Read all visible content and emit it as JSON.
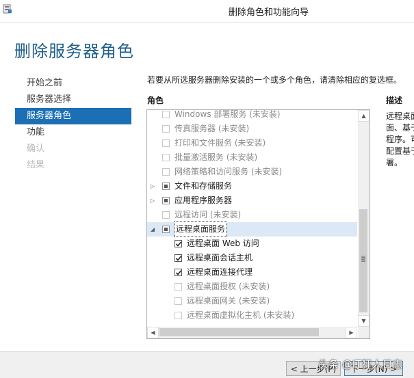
{
  "window": {
    "title": "删除角色和功能向导"
  },
  "page": {
    "title": "删除服务器角色"
  },
  "nav": {
    "items": [
      {
        "label": "开始之前"
      },
      {
        "label": "服务器选择"
      },
      {
        "label": "服务器角色"
      },
      {
        "label": "功能"
      },
      {
        "label": "确认"
      },
      {
        "label": "结果"
      }
    ]
  },
  "main": {
    "instruction": "若要从所选服务器删除安装的一个或多个角色，请清除相应的复选框。",
    "roles_header": "角色",
    "description_header": "描述",
    "description_text": "远程桌面\n面、基于\n程序。可\n配置基于\n署。"
  },
  "roles": [
    {
      "label": "Windows 部署服务 (未安装)",
      "state": "unchecked",
      "installed": false
    },
    {
      "label": "传真服务器 (未安装)",
      "state": "unchecked",
      "installed": false
    },
    {
      "label": "打印和文件服务 (未安装)",
      "state": "unchecked",
      "installed": false
    },
    {
      "label": "批量激活服务 (未安装)",
      "state": "unchecked",
      "installed": false
    },
    {
      "label": "网络策略和访问服务 (未安装)",
      "state": "unchecked",
      "installed": false
    },
    {
      "label": "文件和存储服务",
      "state": "partial",
      "installed": true,
      "expander": "collapsed"
    },
    {
      "label": "应用程序服务器",
      "state": "partial",
      "installed": true,
      "expander": "collapsed"
    },
    {
      "label": "远程访问 (未安装)",
      "state": "unchecked",
      "installed": false
    },
    {
      "label": "远程桌面服务",
      "state": "partial",
      "installed": true,
      "expander": "expanded",
      "selected": true
    },
    {
      "label": "远程桌面 Web 访问",
      "state": "checked",
      "installed": true,
      "child": true
    },
    {
      "label": "远程桌面会话主机",
      "state": "checked",
      "installed": true,
      "child": true
    },
    {
      "label": "远程桌面连接代理",
      "state": "checked",
      "installed": true,
      "child": true
    },
    {
      "label": "远程桌面授权 (未安装)",
      "state": "unchecked",
      "installed": false,
      "child": true
    },
    {
      "label": "远程桌面网关 (未安装)",
      "state": "unchecked",
      "installed": false,
      "child": true
    },
    {
      "label": "远程桌面虚拟化主机 (未安装)",
      "state": "unchecked",
      "installed": false,
      "child": true
    }
  ],
  "buttons": {
    "previous": "< 上一步(P)",
    "next": "下一步(N) >"
  },
  "watermark": "头条 @IT狂人日志",
  "colors": {
    "accent": "#1c6fb4",
    "title": "#1d5e8c",
    "selected_row": "#dbe8f5"
  }
}
